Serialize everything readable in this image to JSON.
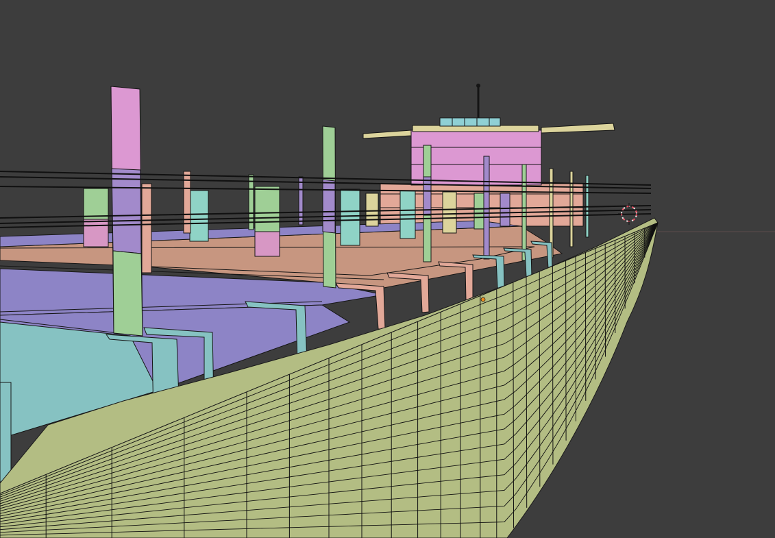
{
  "app": {
    "view": "3D Viewport",
    "shading": "solid-random-color",
    "overlays": {
      "wireframe": true,
      "origin_dot": true,
      "cursor_3d": true
    }
  },
  "colors": {
    "background": "#3d3d3d",
    "hull": "#b3bd83",
    "deck_blue": "#8d84c6",
    "deck_teal": "#86c2c2",
    "deck_salmon": "#c79680",
    "superstructure_pink": "#dc98d2",
    "superstructure_salmon": "#e2a898",
    "bridge_wing": "#dcd49c",
    "bridge_glass": "#8fd0d4",
    "post_pink": "#d797c4",
    "post_purple": "#a28acb",
    "post_green": "#9fcf96",
    "post_teal": "#8fd3c6",
    "wire": "#101010",
    "origin": "#e98b1c",
    "cursor_red": "#e8475b"
  },
  "icons": [
    "3d-cursor-icon",
    "object-origin-icon"
  ]
}
